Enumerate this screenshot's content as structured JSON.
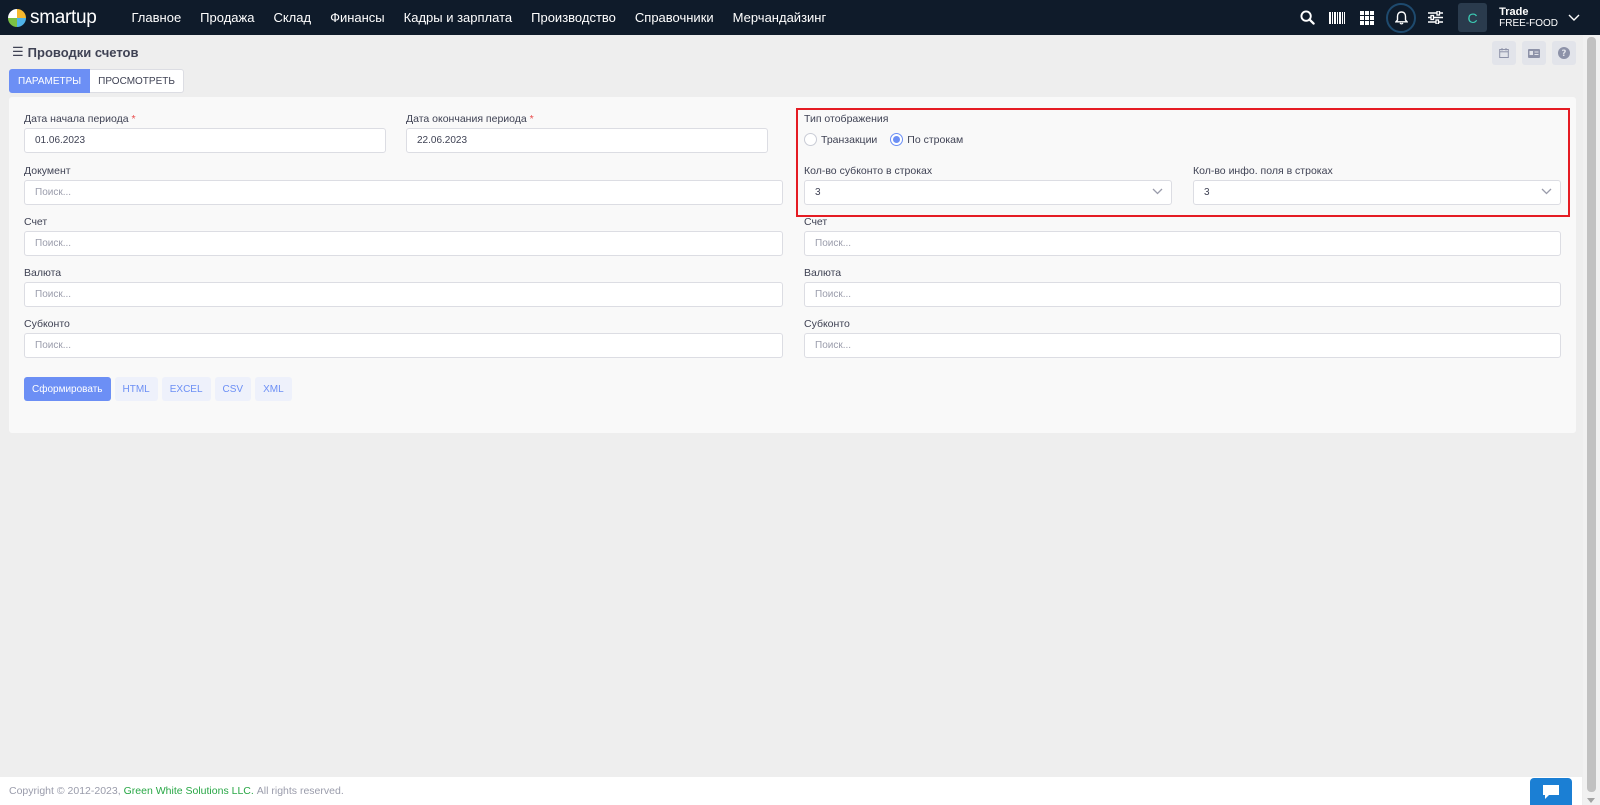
{
  "app": {
    "logo_text": "smartup",
    "nav": [
      "Главное",
      "Продажа",
      "Склад",
      "Финансы",
      "Кадры и зарплата",
      "Производство",
      "Справочники",
      "Мерчандайзинг"
    ],
    "avatar_letter": "C",
    "account_title": "Trade",
    "account_subtitle": "FREE-FOOD",
    "icons": [
      "search-icon",
      "barcode-icon",
      "grid-icon",
      "bell-icon",
      "sliders-icon",
      "chevron-down-icon"
    ]
  },
  "page": {
    "title": "Проводки счетов",
    "tabs": [
      "ПАРАМЕТРЫ",
      "ПРОСМОТРЕТЬ"
    ]
  },
  "form": {
    "start_label": "Дата начала периода",
    "start_value": "01.06.2023",
    "end_label": "Дата окончания периода",
    "end_value": "22.06.2023",
    "required_mark": "*",
    "display_type_label": "Тип отображения",
    "radio_transactions": "Транзакции",
    "radio_rows": "По строкам",
    "radio_selected": "По строкам",
    "subconto_count_label": "Кол-во субконто в строках",
    "subconto_count_value": "3",
    "info_count_label": "Кол-во инфо. поля в строках",
    "info_count_value": "3",
    "document_label": "Документ",
    "left": {
      "account_label": "Счет",
      "currency_label": "Валюта",
      "subconto_label": "Субконто"
    },
    "right": {
      "account_label": "Счет",
      "currency_label": "Валюта",
      "subconto_label": "Субконто"
    },
    "search_placeholder": "Поиск..."
  },
  "actions": {
    "generate": "Сформировать",
    "formats": [
      "HTML",
      "EXCEL",
      "CSV",
      "XML"
    ]
  },
  "footer": {
    "copyright": "Copyright © 2012-2023,",
    "company": "Green White Solutions LLC.",
    "rights": "All rights reserved."
  },
  "colors": {
    "navbar": "#0f1b2a",
    "accent": "#6c8ff5",
    "highlight": "#e51c23",
    "link": "#28a745"
  }
}
